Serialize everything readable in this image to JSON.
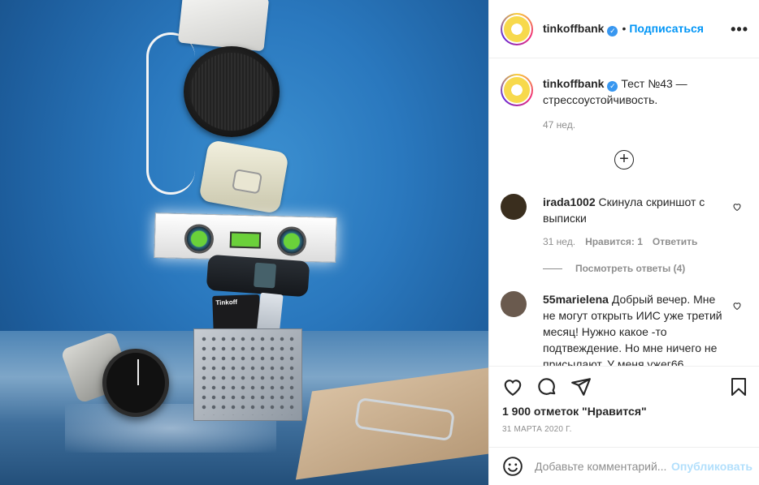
{
  "post": {
    "username": "tinkoffbank",
    "follow_label": "Подписаться",
    "dot": "•",
    "more_label": "•••",
    "verified_glyph": "✓",
    "photo_card_brand": "Tinkoff",
    "caption_text": "Тест №43 — стрессоустойчивость.",
    "caption_age": "47 нед.",
    "load_more_glyph": "+"
  },
  "comments": [
    {
      "username": "irada1002",
      "text": "Скинула скриншот с выписки",
      "age": "31 нед.",
      "likes_label": "Нравится: 1",
      "reply_label": "Ответить",
      "view_replies": "Посмотреть ответы (4)",
      "avatar_color": "#3a2e1e"
    },
    {
      "username": "55marielena",
      "text": "Добрый вечер. Мне не могут открыть ИИС уже третий месяц! Нужно какое -то подтвеждение. Но мне ничего не присылают. У меня ужег66",
      "avatar_color": "#6a5a4e"
    }
  ],
  "actions": {
    "likes_text": "1 900 отметок \"Нравится\"",
    "date_text": "31 МАРТА 2020 Г."
  },
  "add_comment": {
    "placeholder": "Добавьте комментарий...",
    "publish_label": "Опубликовать"
  },
  "colors": {
    "accent": "#0095f6",
    "verified": "#3897f0",
    "secondary_text": "#8e8e8e",
    "publish_disabled": "#b2dffc"
  }
}
